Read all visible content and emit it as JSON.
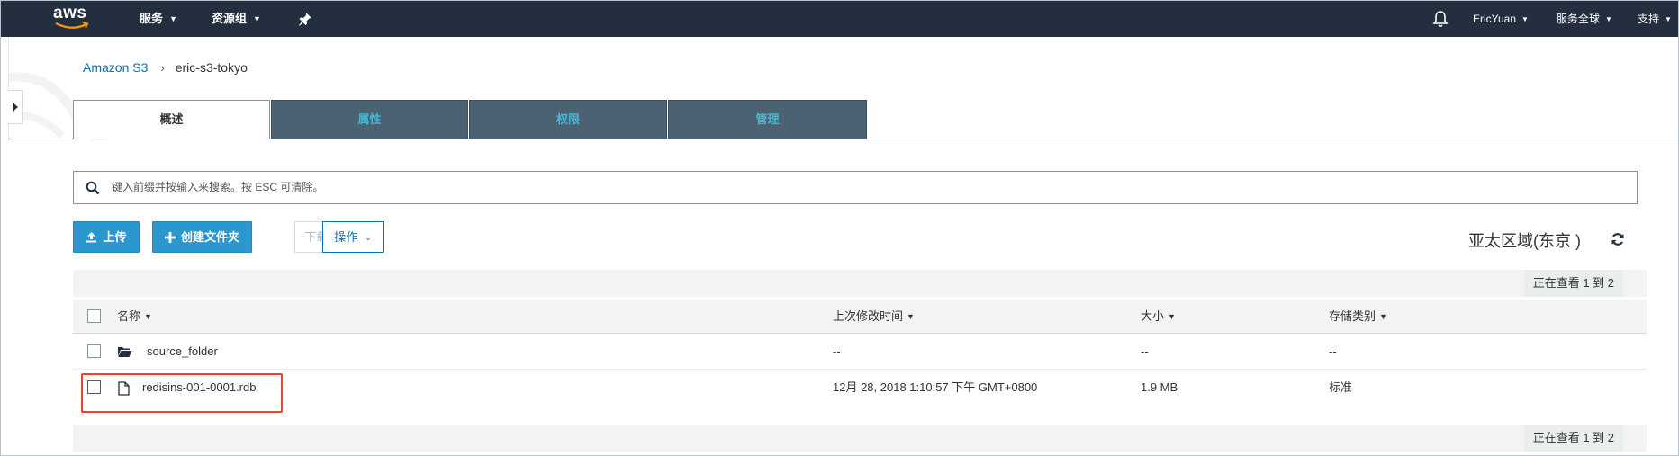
{
  "topnav": {
    "logo_text": "aws",
    "services_label": "服务",
    "resource_groups_label": "资源组",
    "user_label": "EricYuan",
    "region_label": "服务全球",
    "support_label": "支持"
  },
  "breadcrumb": {
    "root": "Amazon S3",
    "separator": "›",
    "bucket": "eric-s3-tokyo"
  },
  "tabs": [
    {
      "label": "概述",
      "active": true
    },
    {
      "label": "属性",
      "active": false
    },
    {
      "label": "权限",
      "active": false
    },
    {
      "label": "管理",
      "active": false
    }
  ],
  "search": {
    "placeholder": "键入前缀并按输入来搜索。按 ESC 可清除。",
    "value": ""
  },
  "toolbar": {
    "upload_label": "上传",
    "create_folder_label": "创建文件夹",
    "download_label": "下载",
    "actions_label": "操作",
    "region_text": "亚太区域(东京 )"
  },
  "table": {
    "pager_text": "正在查看 1 到 2",
    "columns": {
      "name": "名称",
      "last_modified": "上次修改时间",
      "size": "大小",
      "storage_class": "存储类别"
    },
    "rows": [
      {
        "name": "source_folder",
        "type": "folder",
        "last_modified": "--",
        "size": "--",
        "storage_class": "--"
      },
      {
        "name": "redisins-001-0001.rdb",
        "type": "file",
        "last_modified": "12月 28, 2018 1:10:57 下午 GMT+0800",
        "size": "1.9 MB",
        "storage_class": "标准"
      }
    ]
  },
  "colors": {
    "nav_bg": "#232f3e",
    "tab_inactive_bg": "#4b6272",
    "tab_inactive_text": "#44b9d6",
    "primary_button": "#2c96cf",
    "link": "#0073bb",
    "highlight": "#e8452c"
  },
  "icons": [
    "aws-logo",
    "chevron-down-icon",
    "pin-icon",
    "bell-icon",
    "sidebar-toggle-icon",
    "search-icon",
    "upload-icon",
    "plus-icon",
    "refresh-icon",
    "sort-down-icon",
    "folder-icon",
    "file-icon",
    "checkbox-icon"
  ]
}
